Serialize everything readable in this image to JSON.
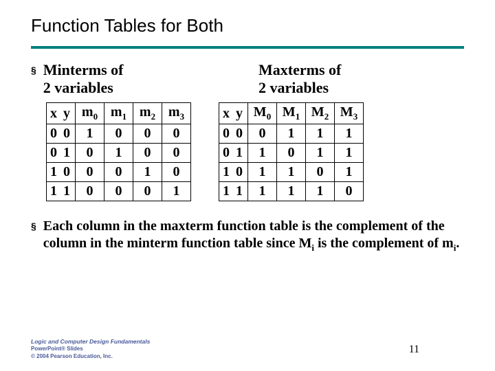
{
  "title": "Function Tables for Both",
  "left_heading": "Minterms of\n2 variables",
  "right_heading": "Maxterms of\n2 variables",
  "minterm_table": {
    "headers": [
      "x y",
      "m0",
      "m1",
      "m2",
      "m3"
    ],
    "rows": [
      [
        "0 0",
        "1",
        "0",
        "0",
        "0"
      ],
      [
        "0 1",
        "0",
        "1",
        "0",
        "0"
      ],
      [
        "1 0",
        "0",
        "0",
        "1",
        "0"
      ],
      [
        "1 1",
        "0",
        "0",
        "0",
        "1"
      ]
    ]
  },
  "maxterm_table": {
    "headers": [
      "x y",
      "M0",
      "M1",
      "M2",
      "M3"
    ],
    "rows": [
      [
        "0 0",
        "0",
        "1",
        "1",
        "1"
      ],
      [
        "0 1",
        "1",
        "0",
        "1",
        "1"
      ],
      [
        "1 0",
        "1",
        "1",
        "0",
        "1"
      ],
      [
        "1 1",
        "1",
        "1",
        "1",
        "0"
      ]
    ]
  },
  "note": "Each column in the maxterm function table is the complement of the column in the minterm function table since Mi is the complement of mi.",
  "footer": {
    "line1": "Logic and Computer Design Fundamentals",
    "line2": "PowerPoint® Slides",
    "line3": "© 2004 Pearson Education, Inc."
  },
  "page_number": "11"
}
